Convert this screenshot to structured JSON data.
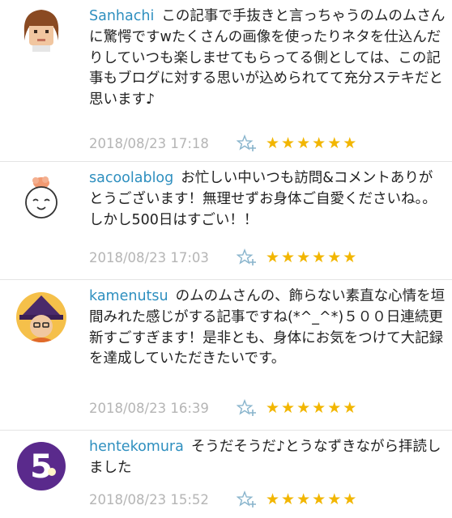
{
  "comments": [
    {
      "username": "Sanhachi",
      "text": "この記事で手抜きと言っちゃうのムのムさんに驚愕ですwたくさんの画像を使ったりネタを仕込んだりしていつも楽しませてもらってる側としては、この記事もブログに対する思いが込められてて充分ステキだと思います♪",
      "timestamp": "2018/08/23 17:18",
      "rating": 6
    },
    {
      "username": "sacoolablog",
      "text": "お忙しい中いつも訪問&コメントありがとうございます！無理せずお身体ご自愛くださいね。。しかし500日はすごい！！",
      "timestamp": "2018/08/23 17:03",
      "rating": 6
    },
    {
      "username": "kamenutsu",
      "text": "のムのムさんの、飾らない素直な心情を垣間みれた感じがする記事ですね(*^_^*)５００日連続更新すごすぎます！是非とも、身体にお気をつけて大記録を達成していただきたいです。",
      "timestamp": "2018/08/23 16:39",
      "rating": 6
    },
    {
      "username": "hentekomura",
      "text": "そうだそうだ♪とうなずきながら拝読しました",
      "timestamp": "2018/08/23 15:52",
      "rating": 6
    }
  ],
  "colors": {
    "username": "#2e8fbf",
    "star": "#f2b600",
    "timestamp": "#b5b5b5"
  },
  "icons": {
    "add_star": "star-plus-icon",
    "star": "star-icon"
  }
}
